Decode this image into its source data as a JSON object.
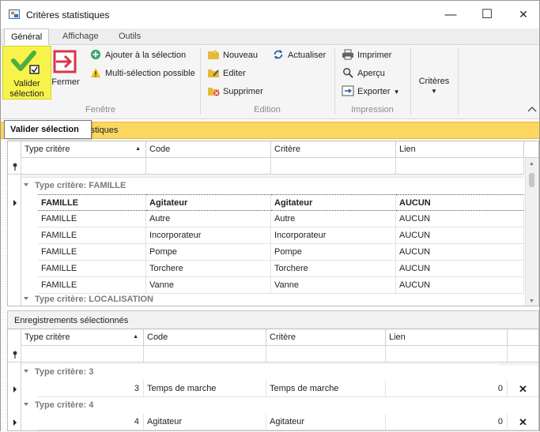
{
  "window": {
    "title": "Critères statistiques",
    "minimize_glyph": "—",
    "maximize_glyph": "☐",
    "close_glyph": "✕"
  },
  "tabs": [
    "Général",
    "Affichage",
    "Outils"
  ],
  "ribbon": {
    "fenetre": {
      "label": "Fenêtre",
      "valider_line1": "Valider",
      "valider_line2": "sélection",
      "fermer": "Fermer",
      "ajouter": "Ajouter à la sélection",
      "multi": "Multi-sélection possible"
    },
    "edition": {
      "label": "Edition",
      "nouveau": "Nouveau",
      "editer": "Editer",
      "supprimer": "Supprimer",
      "actualiser": "Actualiser"
    },
    "impression": {
      "label": "Impression",
      "imprimer": "Imprimer",
      "apercu": "Aperçu",
      "exporter": "Exporter"
    },
    "criteres": "Critères"
  },
  "tooltip": "Valider sélection",
  "yellow_bar_text": "tistiques",
  "top_grid": {
    "columns": [
      "Type critère",
      "Code",
      "Critère",
      "Lien"
    ],
    "groups": [
      {
        "title": "Type critère: FAMILLE",
        "rows": [
          [
            "FAMILLE",
            "Agitateur",
            "Agitateur",
            "AUCUN"
          ],
          [
            "FAMILLE",
            "Autre",
            "Autre",
            "AUCUN"
          ],
          [
            "FAMILLE",
            "Incorporateur",
            "Incorporateur",
            "AUCUN"
          ],
          [
            "FAMILLE",
            "Pompe",
            "Pompe",
            "AUCUN"
          ],
          [
            "FAMILLE",
            "Torchere",
            "Torchere",
            "AUCUN"
          ],
          [
            "FAMILLE",
            "Vanne",
            "Vanne",
            "AUCUN"
          ]
        ]
      },
      {
        "title": "Type critère: LOCALISATION",
        "rows": []
      }
    ]
  },
  "bottom_section_title": "Enregistrements sélectionnés",
  "bottom_grid": {
    "columns": [
      "Type critère",
      "Code",
      "Critère",
      "Lien"
    ],
    "groups": [
      {
        "title": "Type critère: 3",
        "rows": [
          [
            "3",
            "Temps de marche",
            "Temps de marche",
            "0",
            "✕"
          ]
        ]
      },
      {
        "title": "Type critère: 4",
        "rows": [
          [
            "4",
            "Agitateur",
            "Agitateur",
            "0",
            "✕"
          ]
        ]
      }
    ]
  },
  "colors": {
    "highlight_yellow": "#f8f34a",
    "header_yellow": "#fbd660",
    "check_green": "#4fae3f",
    "close_red": "#d9354a"
  }
}
